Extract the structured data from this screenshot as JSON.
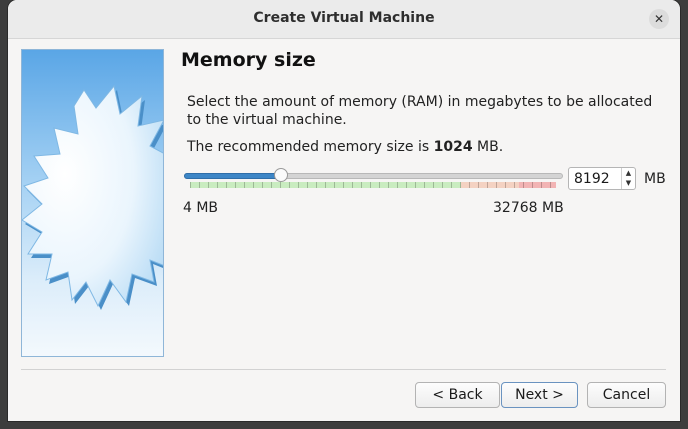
{
  "window": {
    "title": "Create Virtual Machine",
    "close_glyph": "✕"
  },
  "page": {
    "title": "Memory size",
    "description": "Select the amount of memory (RAM) in megabytes to be allocated to the virtual machine.",
    "recommended_prefix": "The recommended memory size is ",
    "recommended_value": "1024",
    "recommended_suffix": " MB."
  },
  "memory": {
    "slider_min_label": "4 MB",
    "slider_max_label": "32768 MB",
    "value": "8192",
    "unit": "MB",
    "min_mb": 4,
    "max_mb": 32768,
    "current_mb": 8192,
    "green_end_fraction": 0.74,
    "orange_end_fraction": 0.9,
    "colors": {
      "fill": "#3d86c6",
      "green": "#c9ecc0",
      "orange": "#f4d2c2",
      "red": "#f2b4b4"
    }
  },
  "buttons": {
    "back": "< Back",
    "next": "Next >",
    "cancel": "Cancel"
  }
}
